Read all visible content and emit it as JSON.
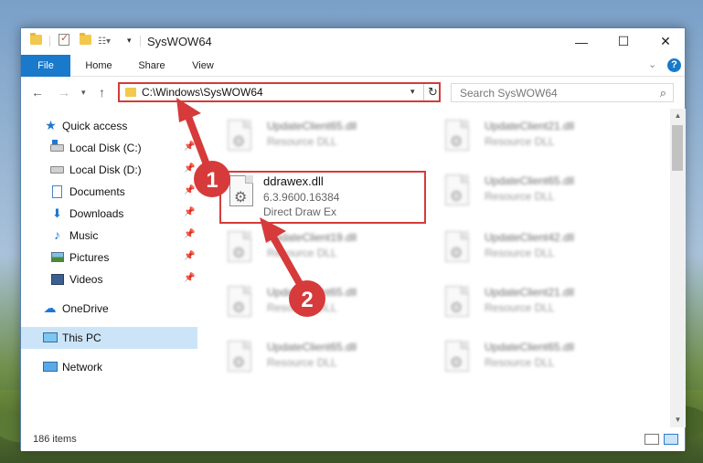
{
  "window": {
    "title": "SysWOW64",
    "controls": {
      "minimize": "—",
      "maximize": "☐",
      "close": "✕"
    }
  },
  "ribbon": {
    "tabs": [
      "File",
      "Home",
      "Share",
      "View"
    ],
    "help": "?"
  },
  "address_bar": {
    "path": "C:\\Windows\\SysWOW64",
    "refresh": "↻"
  },
  "search": {
    "placeholder": "Search SysWOW64"
  },
  "sidebar": {
    "items": [
      {
        "label": "Quick access",
        "icon": "star-icon",
        "pinned": false
      },
      {
        "label": "Local Disk (C:)",
        "icon": "windows-drive-icon",
        "pinned": true
      },
      {
        "label": "Local Disk (D:)",
        "icon": "drive-icon",
        "pinned": true
      },
      {
        "label": "Documents",
        "icon": "documents-icon",
        "pinned": true
      },
      {
        "label": "Downloads",
        "icon": "download-icon",
        "pinned": true
      },
      {
        "label": "Music",
        "icon": "music-icon",
        "pinned": true
      },
      {
        "label": "Pictures",
        "icon": "pictures-icon",
        "pinned": true
      },
      {
        "label": "Videos",
        "icon": "videos-icon",
        "pinned": true
      },
      {
        "label": "OneDrive",
        "icon": "cloud-icon",
        "pinned": false
      },
      {
        "label": "This PC",
        "icon": "computer-icon",
        "pinned": false,
        "selected": true
      },
      {
        "label": "Network",
        "icon": "network-icon",
        "pinned": false
      }
    ]
  },
  "files": {
    "blurred": [
      {
        "name": "UpdateClient65.dll",
        "type": "Resource DLL"
      },
      {
        "name": "UpdateClient21.dll",
        "type": "Resource DLL"
      },
      {
        "name": "UpdateClient65.dll",
        "type": "Resource DLL"
      },
      {
        "name": "UpdateClient19.dll",
        "type": "Resource DLL"
      },
      {
        "name": "UpdateClient42.dll",
        "type": "Resource DLL"
      },
      {
        "name": "UpdateClient65.dll",
        "type": "Resource DLL"
      },
      {
        "name": "UpdateClient21.dll",
        "type": "Resource DLL"
      },
      {
        "name": "UpdateClient65.dll",
        "type": "Resource DLL"
      },
      {
        "name": "UpdateClient65.dll",
        "type": "Resource DLL"
      }
    ],
    "highlighted": {
      "name": "ddrawex.dll",
      "version": "6.3.9600.16384",
      "description": "Direct Draw Ex"
    }
  },
  "status": {
    "item_count": "186 items"
  },
  "annotations": {
    "step1": "1",
    "step2": "2",
    "color": "#d63a3a"
  }
}
